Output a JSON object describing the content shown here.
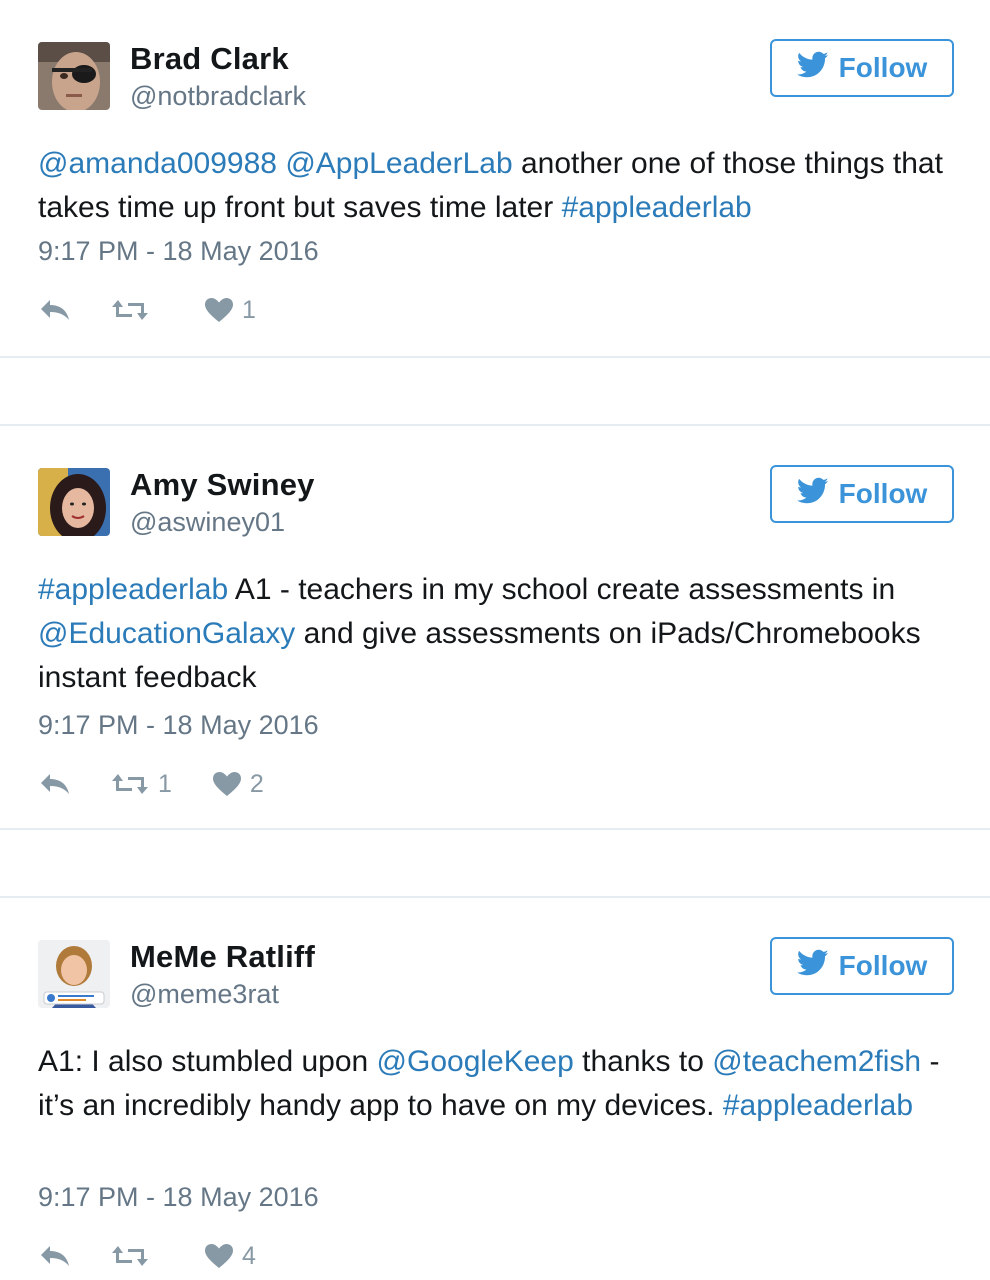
{
  "colors": {
    "link": "#2b7bb9",
    "follow": "#3b94d9",
    "muted": "#657786",
    "icon": "#8899a6"
  },
  "tweets": [
    {
      "name": "Brad Clark",
      "handle": "@notbradclark",
      "follow_label": "Follow",
      "text": [
        {
          "t": "@amanda009988",
          "link": true
        },
        {
          "t": " ",
          "link": false
        },
        {
          "t": "@AppLeaderLab",
          "link": true
        },
        {
          "t": " another one of those things that takes time up front but saves time later ",
          "link": false
        },
        {
          "t": "#appleaderlab",
          "link": true
        }
      ],
      "timestamp": "9:17 PM - 18 May 2016",
      "retweets": "",
      "likes": "1"
    },
    {
      "name": "Amy Swiney",
      "handle": "@aswiney01",
      "follow_label": "Follow",
      "text": [
        {
          "t": "#appleaderlab",
          "link": true
        },
        {
          "t": " A1 - teachers in my school create assessments in ",
          "link": false
        },
        {
          "t": "@EducationGalaxy",
          "link": true
        },
        {
          "t": " and give assessments on iPads/Chromebooks instant feedback",
          "link": false
        }
      ],
      "timestamp": "9:17 PM - 18 May 2016",
      "retweets": "1",
      "likes": "2"
    },
    {
      "name": "MeMe Ratliff",
      "handle": "@meme3rat",
      "follow_label": "Follow",
      "text": [
        {
          "t": "A1: I also stumbled upon ",
          "link": false
        },
        {
          "t": "@GoogleKeep",
          "link": true
        },
        {
          "t": " thanks to ",
          "link": false
        },
        {
          "t": "@teachem2fish",
          "link": true
        },
        {
          "t": " - it’s an incredibly handy app to have on my devices. ",
          "link": false
        },
        {
          "t": "#appleaderlab",
          "link": true
        }
      ],
      "timestamp": "9:17 PM - 18 May 2016",
      "retweets": "",
      "likes": "4"
    }
  ]
}
